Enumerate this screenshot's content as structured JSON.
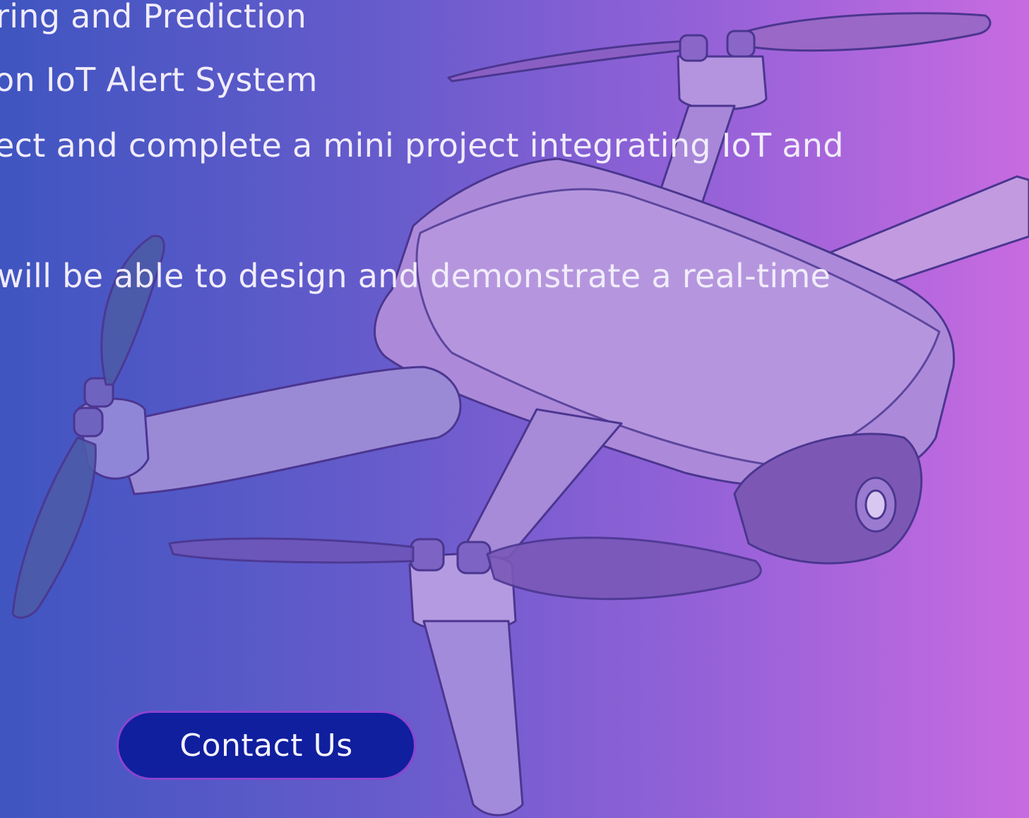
{
  "content": {
    "lines": [
      "ring and Prediction",
      "on IoT Alert System",
      "ect and complete a mini project integrating IoT and",
      "will be able to design and demonstrate a real-time"
    ]
  },
  "cta": {
    "label": "Contact Us"
  },
  "illustration": {
    "icon": "drone-icon"
  },
  "colors": {
    "gradient_start": "#3f55c0",
    "gradient_end": "#c86be0",
    "button_bg": "#101f9e",
    "button_border": "#8a45cf",
    "text": "#f1ecfb"
  }
}
